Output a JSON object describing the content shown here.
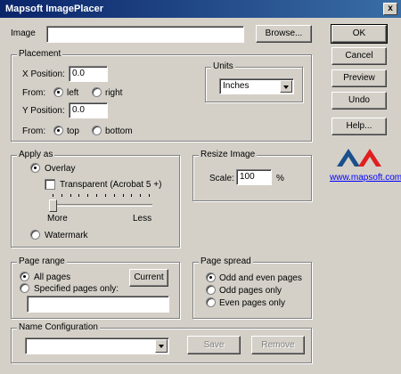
{
  "window": {
    "title": "Mapsoft ImagePlacer",
    "close_glyph": "x"
  },
  "image": {
    "label": "Image",
    "value": "",
    "browse_label": "Browse..."
  },
  "side_buttons": {
    "ok": "OK",
    "cancel": "Cancel",
    "preview": "Preview",
    "undo": "Undo",
    "help": "Help..."
  },
  "logo": {
    "link_text": "www.mapsoft.com",
    "colors": [
      "#1b4f8c",
      "#e02020"
    ]
  },
  "placement": {
    "title": "Placement",
    "x_label": "X Position:",
    "x_value": "0.0",
    "from_label": "From:",
    "left_label": "left",
    "right_label": "right",
    "y_label": "Y Position:",
    "y_value": "0.0",
    "top_label": "top",
    "bottom_label": "bottom",
    "x_from_selected": "left",
    "y_from_selected": "top"
  },
  "units": {
    "title": "Units",
    "selected": "Inches"
  },
  "apply_as": {
    "title": "Apply as",
    "overlay_label": "Overlay",
    "transparent_label": "Transparent (Acrobat 5 +)",
    "transparent_checked": false,
    "more_label": "More",
    "less_label": "Less",
    "slider_level": 0,
    "watermark_label": "Watermark",
    "selected": "overlay"
  },
  "resize": {
    "title": "Resize Image",
    "scale_label": "Scale:",
    "scale_value": "100",
    "unit": "%"
  },
  "page_range": {
    "title": "Page range",
    "all_label": "All pages",
    "specified_label": "Specified pages only:",
    "current_label": "Current",
    "pages_value": "",
    "selected": "all"
  },
  "page_spread": {
    "title": "Page spread",
    "options": [
      "Odd and even pages",
      "Odd pages only",
      "Even pages only"
    ],
    "selected_index": 0
  },
  "name_config": {
    "title": "Name Configuration",
    "selected": "",
    "save_label": "Save",
    "remove_label": "Remove"
  }
}
